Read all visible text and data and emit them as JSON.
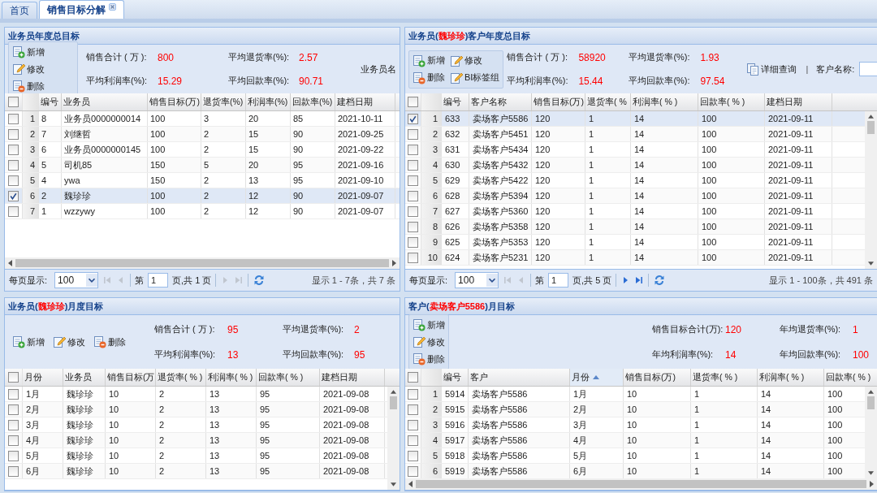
{
  "tabs": [
    {
      "label": "首页",
      "selected": false,
      "closable": false
    },
    {
      "label": "销售目标分解",
      "selected": true,
      "closable": true
    }
  ],
  "panels": [
    {
      "title": [
        {
          "text": "业务员年度总目标",
          "highlight": false
        }
      ],
      "buttons": [
        {
          "kind": "add",
          "label": "新增"
        },
        {
          "kind": "edit",
          "label": "修改"
        },
        {
          "kind": "delete",
          "label": "删除"
        }
      ],
      "stats": [
        {
          "label": "销售合计 ( 万 ):",
          "value": "800"
        },
        {
          "label": "平均退货率(%):",
          "value": "2.57"
        },
        {
          "label": "平均利润率(%):",
          "value": "15.29"
        },
        {
          "label": "平均回款率(%):",
          "value": "90.71"
        }
      ],
      "search": {
        "label": "业务员名"
      },
      "table": {
        "all_selected": false,
        "columns": [
          {
            "label": "编号"
          },
          {
            "label": "业务员"
          },
          {
            "label": "销售目标(万)"
          },
          {
            "label": "退货率(%)"
          },
          {
            "label": "利润率(%)"
          },
          {
            "label": "回款率(%)"
          },
          {
            "label": "建档日期"
          }
        ],
        "rows": [
          {
            "selected": false,
            "num": "1",
            "cells": [
              "8",
              "业务员0000000014",
              "100",
              "3",
              "20",
              "85",
              "2021-10-11"
            ]
          },
          {
            "selected": false,
            "num": "2",
            "cells": [
              "7",
              "刘继哲",
              "100",
              "2",
              "15",
              "90",
              "2021-09-25"
            ]
          },
          {
            "selected": false,
            "num": "3",
            "cells": [
              "6",
              "业务员0000000145",
              "100",
              "2",
              "15",
              "90",
              "2021-09-22"
            ]
          },
          {
            "selected": false,
            "num": "4",
            "cells": [
              "5",
              "司机85",
              "150",
              "5",
              "20",
              "95",
              "2021-09-16"
            ]
          },
          {
            "selected": false,
            "num": "5",
            "cells": [
              "4",
              "ywa",
              "150",
              "2",
              "13",
              "95",
              "2021-09-10"
            ]
          },
          {
            "selected": true,
            "num": "6",
            "cells": [
              "2",
              "魏珍珍",
              "100",
              "2",
              "12",
              "90",
              "2021-09-07"
            ]
          },
          {
            "selected": false,
            "num": "7",
            "cells": [
              "1",
              "wzzywy",
              "100",
              "2",
              "12",
              "90",
              "2021-09-07"
            ]
          }
        ]
      },
      "pager": {
        "size_label": "每页显示:",
        "size": "100",
        "page_prefix": "第",
        "page": "1",
        "page_suffix": "页,共 1 页",
        "info": "显示 1 - 7条，共 7 条",
        "can_back": false,
        "can_forward": false
      }
    },
    {
      "title": [
        {
          "text": "业务员(",
          "highlight": false
        },
        {
          "text": "魏珍珍",
          "highlight": true
        },
        {
          "text": ")客户年度总目标",
          "highlight": false
        }
      ],
      "buttons": [
        {
          "kind": "add",
          "label": "新增"
        },
        {
          "kind": "edit",
          "label": "修改"
        },
        {
          "kind": "delete",
          "label": "删除"
        },
        {
          "kind": "edit",
          "label": "BI标签组"
        }
      ],
      "stats": [
        {
          "label": "销售合计 ( 万 ):",
          "value": "58920"
        },
        {
          "label": "平均退货率(%):",
          "value": "1.93"
        },
        {
          "label": "平均利润率(%):",
          "value": "15.44"
        },
        {
          "label": "平均回款率(%):",
          "value": "97.54"
        }
      ],
      "search": {
        "button": "详细查询",
        "separator": "|",
        "label": "客户名称:"
      },
      "table": {
        "all_selected": false,
        "columns": [
          {
            "label": "编号"
          },
          {
            "label": "客户名称"
          },
          {
            "label": "销售目标(万)"
          },
          {
            "label": "退货率( %"
          },
          {
            "label": "利润率( % )"
          },
          {
            "label": "回款率( % )"
          },
          {
            "label": "建档日期"
          }
        ],
        "rows": [
          {
            "selected": true,
            "num": "1",
            "cells": [
              "633",
              "卖场客户5586",
              "120",
              "1",
              "14",
              "100",
              "2021-09-11"
            ]
          },
          {
            "selected": false,
            "num": "2",
            "cells": [
              "632",
              "卖场客户5451",
              "120",
              "1",
              "14",
              "100",
              "2021-09-11"
            ]
          },
          {
            "selected": false,
            "num": "3",
            "cells": [
              "631",
              "卖场客户5434",
              "120",
              "1",
              "14",
              "100",
              "2021-09-11"
            ]
          },
          {
            "selected": false,
            "num": "4",
            "cells": [
              "630",
              "卖场客户5432",
              "120",
              "1",
              "14",
              "100",
              "2021-09-11"
            ]
          },
          {
            "selected": false,
            "num": "5",
            "cells": [
              "629",
              "卖场客户5422",
              "120",
              "1",
              "14",
              "100",
              "2021-09-11"
            ]
          },
          {
            "selected": false,
            "num": "6",
            "cells": [
              "628",
              "卖场客户5394",
              "120",
              "1",
              "14",
              "100",
              "2021-09-11"
            ]
          },
          {
            "selected": false,
            "num": "7",
            "cells": [
              "627",
              "卖场客户5360",
              "120",
              "1",
              "14",
              "100",
              "2021-09-11"
            ]
          },
          {
            "selected": false,
            "num": "8",
            "cells": [
              "626",
              "卖场客户5358",
              "120",
              "1",
              "14",
              "100",
              "2021-09-11"
            ]
          },
          {
            "selected": false,
            "num": "9",
            "cells": [
              "625",
              "卖场客户5353",
              "120",
              "1",
              "14",
              "100",
              "2021-09-11"
            ]
          },
          {
            "selected": false,
            "num": "10",
            "cells": [
              "624",
              "卖场客户5231",
              "120",
              "1",
              "14",
              "100",
              "2021-09-11"
            ]
          }
        ]
      },
      "pager": {
        "size_label": "每页显示:",
        "size": "100",
        "page_prefix": "第",
        "page": "1",
        "page_suffix": "页,共 5 页",
        "info": "显示 1 - 100条，共 491 条",
        "can_back": false,
        "can_forward": true
      }
    },
    {
      "title": [
        {
          "text": "业务员(",
          "highlight": false
        },
        {
          "text": "魏珍珍",
          "highlight": true
        },
        {
          "text": ")月度目标",
          "highlight": false
        }
      ],
      "buttons": [
        {
          "kind": "add",
          "label": "新增"
        },
        {
          "kind": "edit",
          "label": "修改"
        },
        {
          "kind": "delete",
          "label": "删除"
        }
      ],
      "stats": [
        {
          "label": "销售合计 ( 万 ):",
          "value": "95"
        },
        {
          "label": "平均退货率(%):",
          "value": "2"
        },
        {
          "label": "平均利润率(%):",
          "value": "13"
        },
        {
          "label": "平均回款率(%):",
          "value": "95"
        }
      ],
      "table": {
        "all_selected": false,
        "columns": [
          {
            "label": "月份"
          },
          {
            "label": "业务员"
          },
          {
            "label": "销售目标(万"
          },
          {
            "label": "退货率( % )"
          },
          {
            "label": "利润率( % )"
          },
          {
            "label": "回款率( % )"
          },
          {
            "label": "建档日期"
          }
        ],
        "rows": [
          {
            "selected": false,
            "cells": [
              "1月",
              "魏珍珍",
              "10",
              "2",
              "13",
              "95",
              "2021-09-08"
            ]
          },
          {
            "selected": false,
            "cells": [
              "2月",
              "魏珍珍",
              "10",
              "2",
              "13",
              "95",
              "2021-09-08"
            ]
          },
          {
            "selected": false,
            "cells": [
              "3月",
              "魏珍珍",
              "10",
              "2",
              "13",
              "95",
              "2021-09-08"
            ]
          },
          {
            "selected": false,
            "cells": [
              "4月",
              "魏珍珍",
              "10",
              "2",
              "13",
              "95",
              "2021-09-08"
            ]
          },
          {
            "selected": false,
            "cells": [
              "5月",
              "魏珍珍",
              "10",
              "2",
              "13",
              "95",
              "2021-09-08"
            ]
          },
          {
            "selected": false,
            "cells": [
              "6月",
              "魏珍珍",
              "10",
              "2",
              "13",
              "95",
              "2021-09-08"
            ]
          }
        ]
      }
    },
    {
      "title": [
        {
          "text": "客户(",
          "highlight": false
        },
        {
          "text": "卖场客户5586",
          "highlight": true
        },
        {
          "text": ")月目标",
          "highlight": false
        }
      ],
      "buttons": [
        {
          "kind": "add",
          "label": "新增"
        },
        {
          "kind": "edit",
          "label": "修改"
        },
        {
          "kind": "delete",
          "label": "删除"
        }
      ],
      "stats": [
        {
          "label": "销售目标合计(万):",
          "value": "120"
        },
        {
          "label": "年均退货率(%):",
          "value": "1"
        },
        {
          "label": "年均利润率(%):",
          "value": "14"
        },
        {
          "label": "年均回款率(%):",
          "value": "100"
        }
      ],
      "table": {
        "all_selected": false,
        "columns": [
          {
            "label": "编号",
            "sorted_ascending": false
          },
          {
            "label": "客户",
            "sorted_ascending": false
          },
          {
            "label": "月份",
            "sorted_ascending": true
          },
          {
            "label": "销售目标(万)",
            "sorted_ascending": false
          },
          {
            "label": "退货率( % )",
            "sorted_ascending": false
          },
          {
            "label": "利润率( % )",
            "sorted_ascending": false
          },
          {
            "label": "回款率( % )",
            "sorted_ascending": false
          }
        ],
        "rows": [
          {
            "selected": false,
            "num": "1",
            "cells": [
              "5914",
              "卖场客户5586",
              "1月",
              "10",
              "1",
              "14",
              "100"
            ]
          },
          {
            "selected": false,
            "num": "2",
            "cells": [
              "5915",
              "卖场客户5586",
              "2月",
              "10",
              "1",
              "14",
              "100"
            ]
          },
          {
            "selected": false,
            "num": "3",
            "cells": [
              "5916",
              "卖场客户5586",
              "3月",
              "10",
              "1",
              "14",
              "100"
            ]
          },
          {
            "selected": false,
            "num": "4",
            "cells": [
              "5917",
              "卖场客户5586",
              "4月",
              "10",
              "1",
              "14",
              "100"
            ]
          },
          {
            "selected": false,
            "num": "5",
            "cells": [
              "5918",
              "卖场客户5586",
              "5月",
              "10",
              "1",
              "14",
              "100"
            ]
          },
          {
            "selected": false,
            "num": "6",
            "cells": [
              "5919",
              "卖场客户5586",
              "6月",
              "10",
              "1",
              "14",
              "100"
            ]
          }
        ]
      }
    }
  ]
}
